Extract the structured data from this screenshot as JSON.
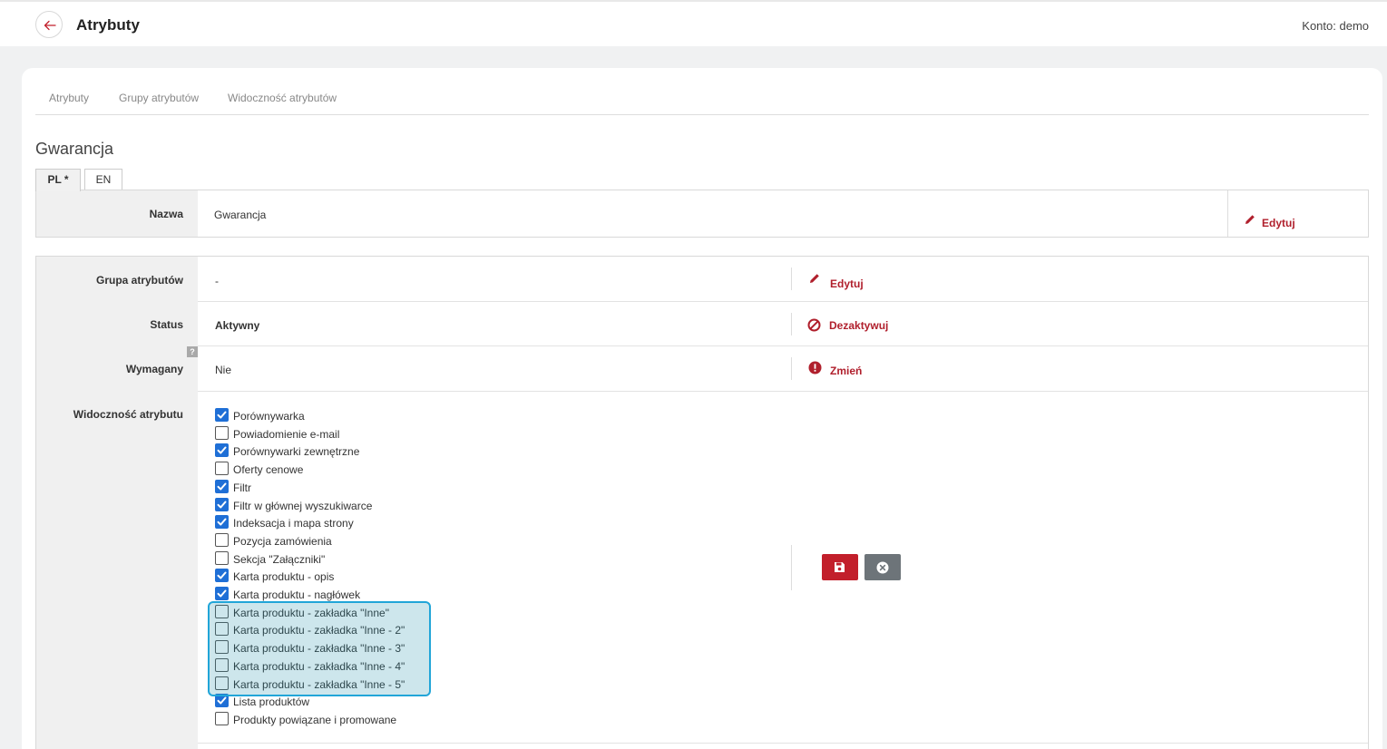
{
  "header": {
    "title": "Atrybuty",
    "account_label": "Konto: demo"
  },
  "subnav": [
    {
      "label": "Atrybuty"
    },
    {
      "label": "Grupy atrybutów"
    },
    {
      "label": "Widoczność atrybutów"
    }
  ],
  "section_title": "Gwarancja",
  "lang_tabs": [
    {
      "label": "PL *",
      "active": true
    },
    {
      "label": "EN",
      "active": false
    }
  ],
  "name_row": {
    "label": "Nazwa",
    "value": "Gwarancja",
    "action": "Edytuj"
  },
  "rows": {
    "group": {
      "label": "Grupa atrybutów",
      "value": "-",
      "action": "Edytuj"
    },
    "status": {
      "label": "Status",
      "value": "Aktywny",
      "action": "Dezaktywuj"
    },
    "required": {
      "label": "Wymagany",
      "value": "Nie",
      "action": "Zmień",
      "help": "?"
    },
    "visibility": {
      "label": "Widoczność atrybutu"
    }
  },
  "visibility_options": [
    {
      "label": "Porównywarka",
      "checked": true
    },
    {
      "label": "Powiadomienie e-mail",
      "checked": false
    },
    {
      "label": "Porównywarki zewnętrzne",
      "checked": true
    },
    {
      "label": "Oferty cenowe",
      "checked": false
    },
    {
      "label": "Filtr",
      "checked": true
    },
    {
      "label": "Filtr w głównej wyszukiwarce",
      "checked": true
    },
    {
      "label": "Indeksacja i mapa strony",
      "checked": true
    },
    {
      "label": "Pozycja zamówienia",
      "checked": false
    },
    {
      "label": "Sekcja \"Załączniki\"",
      "checked": false
    },
    {
      "label": "Karta produktu - opis",
      "checked": true
    },
    {
      "label": "Karta produktu - nagłówek",
      "checked": true
    },
    {
      "label": "Karta produktu - zakładka \"Inne\"",
      "checked": false
    },
    {
      "label": "Karta produktu - zakładka \"Inne - 2\"",
      "checked": false
    },
    {
      "label": "Karta produktu - zakładka \"Inne - 3\"",
      "checked": false
    },
    {
      "label": "Karta produktu - zakładka \"Inne - 4\"",
      "checked": false
    },
    {
      "label": "Karta produktu - zakładka \"Inne - 5\"",
      "checked": false
    },
    {
      "label": "Lista produktów",
      "checked": true
    },
    {
      "label": "Produkty powiązane i promowane",
      "checked": false
    }
  ],
  "colors": {
    "accent": "#b01f2c",
    "save_button": "#c21f2b",
    "cancel_button": "#6d7479",
    "checkbox_checked": "#1f6fd6",
    "highlight_border": "#21a5d8"
  },
  "icons": {
    "back": "arrow-left-icon",
    "edit": "pencil-icon",
    "deactivate": "ban-icon",
    "change": "exclamation-circle-icon",
    "save": "floppy-disk-icon",
    "cancel": "x-circle-icon"
  }
}
